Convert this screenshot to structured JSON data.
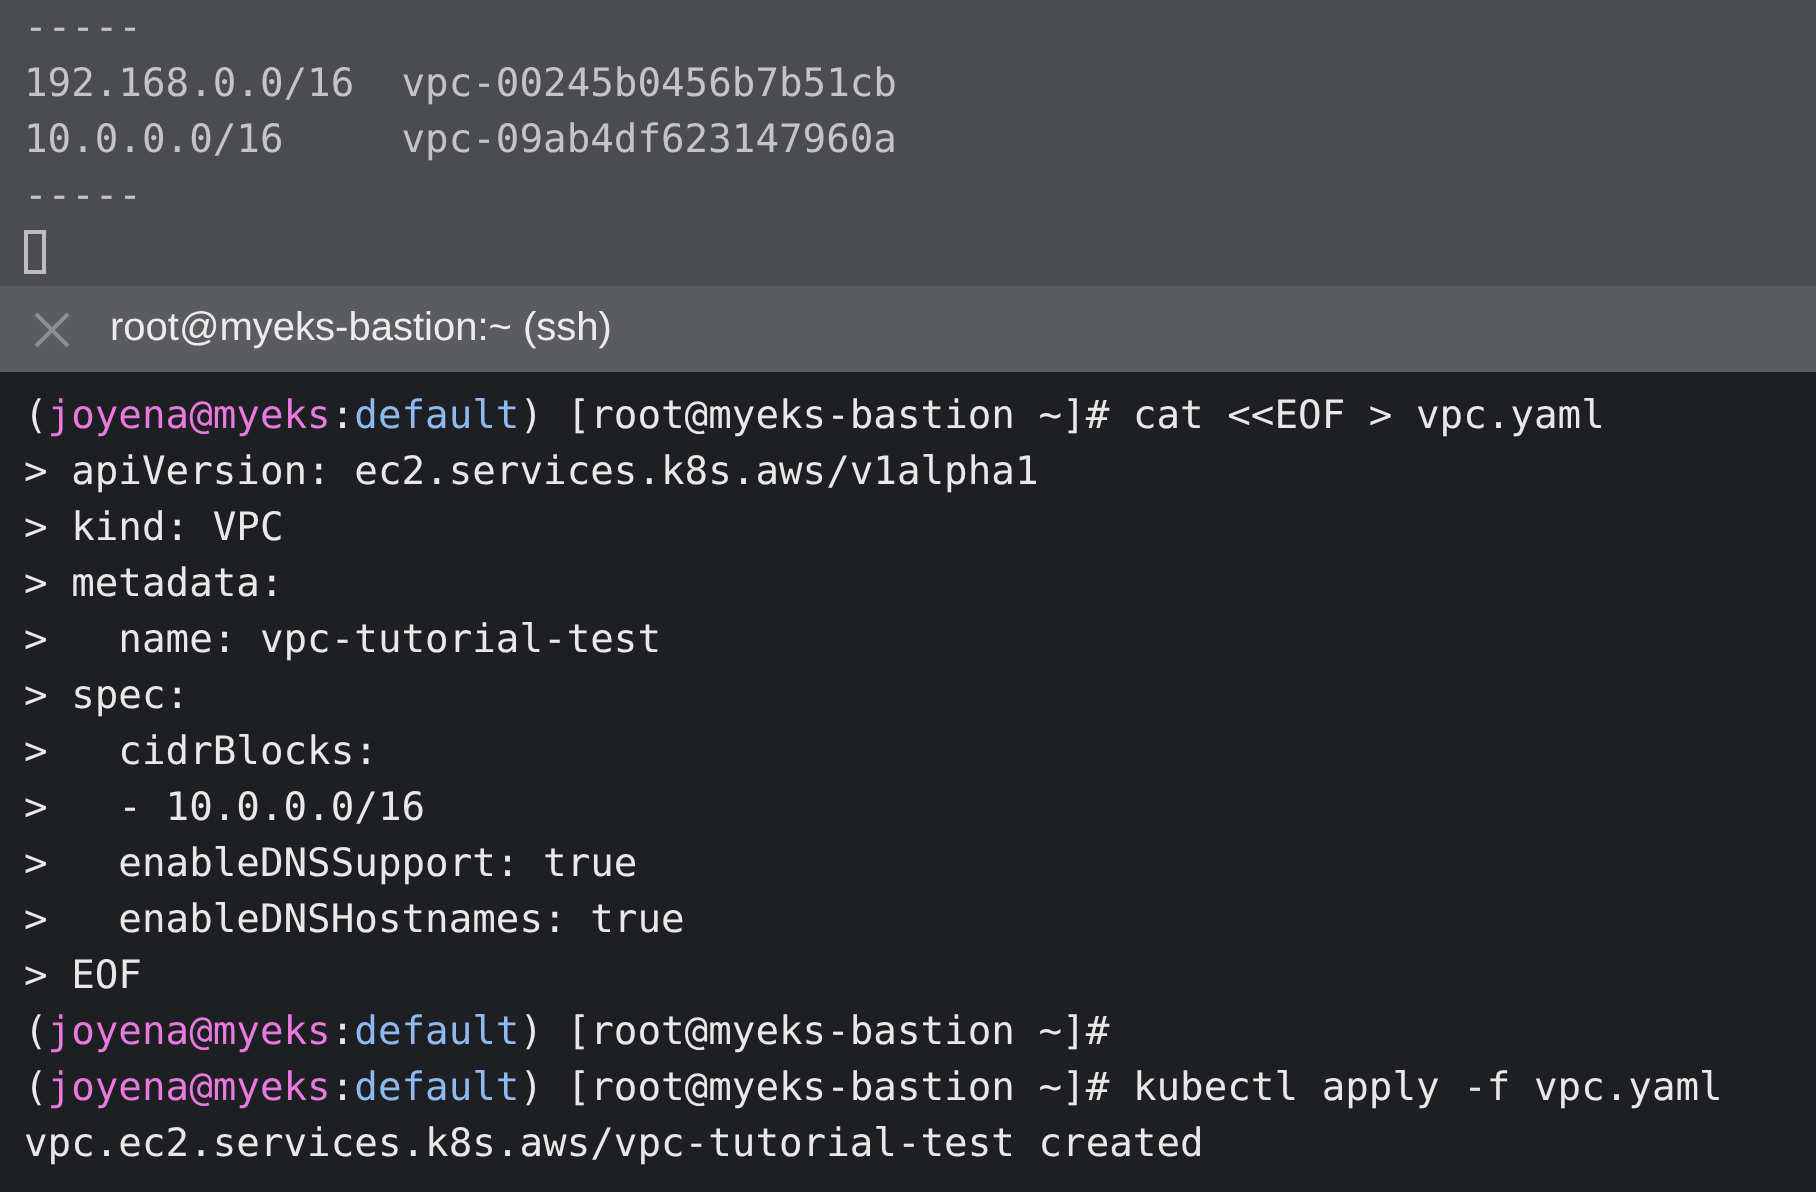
{
  "top_pane": {
    "focused": false,
    "lines": [
      "-----",
      "192.168.0.0/16  vpc-00245b0456b7b51cb",
      "10.0.0.0/16     vpc-09ab4df623147960a",
      "-----"
    ],
    "cursor": true
  },
  "tab": {
    "title": "root@myeks-bastion:~ (ssh)"
  },
  "bottom_pane": {
    "focused": true,
    "lines": [
      {
        "kind": "prompt",
        "segments": [
          {
            "text": "(",
            "color": "#e8e8e8"
          },
          {
            "text": "joyena@myeks",
            "color": "#e879e0"
          },
          {
            "text": ":",
            "color": "#e8e8e8"
          },
          {
            "text": "default",
            "color": "#8fb9f2"
          },
          {
            "text": ") [root@myeks-bastion ~]# cat <<EOF > vpc.yaml",
            "color": "#e8e8e8"
          }
        ]
      },
      {
        "kind": "output",
        "text": "> apiVersion: ec2.services.k8s.aws/v1alpha1"
      },
      {
        "kind": "output",
        "text": "> kind: VPC"
      },
      {
        "kind": "output",
        "text": "> metadata:"
      },
      {
        "kind": "output",
        "text": ">   name: vpc-tutorial-test"
      },
      {
        "kind": "output",
        "text": "> spec:"
      },
      {
        "kind": "output",
        "text": ">   cidrBlocks:"
      },
      {
        "kind": "output",
        "text": ">   - 10.0.0.0/16"
      },
      {
        "kind": "output",
        "text": ">   enableDNSSupport: true"
      },
      {
        "kind": "output",
        "text": ">   enableDNSHostnames: true"
      },
      {
        "kind": "output",
        "text": "> EOF"
      },
      {
        "kind": "prompt",
        "segments": [
          {
            "text": "(",
            "color": "#e8e8e8"
          },
          {
            "text": "joyena@myeks",
            "color": "#e879e0"
          },
          {
            "text": ":",
            "color": "#e8e8e8"
          },
          {
            "text": "default",
            "color": "#8fb9f2"
          },
          {
            "text": ") [root@myeks-bastion ~]#",
            "color": "#e8e8e8"
          }
        ]
      },
      {
        "kind": "prompt",
        "segments": [
          {
            "text": "(",
            "color": "#e8e8e8"
          },
          {
            "text": "joyena@myeks",
            "color": "#e879e0"
          },
          {
            "text": ":",
            "color": "#e8e8e8"
          },
          {
            "text": "default",
            "color": "#8fb9f2"
          },
          {
            "text": ") [root@myeks-bastion ~]# kubectl apply -f vpc.yaml",
            "color": "#e8e8e8"
          }
        ]
      },
      {
        "kind": "output",
        "text": "vpc.ec2.services.k8s.aws/vpc-tutorial-test created"
      }
    ]
  }
}
